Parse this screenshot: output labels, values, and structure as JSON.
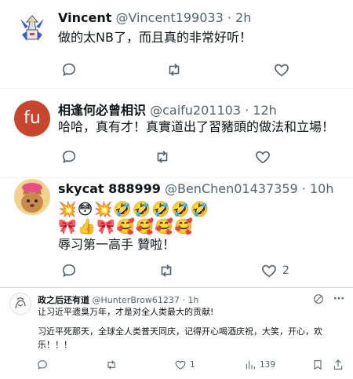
{
  "tweets": [
    {
      "name": "Vincent",
      "handle": "@Vincent199033",
      "time": "2h",
      "text": "做的太NB了，而且真的非常好听！",
      "avatar_icon": "robot-avatar"
    },
    {
      "name": "相逢何必曾相识",
      "handle": "@caifu201103",
      "time": "12h",
      "text": "哈哈，真有才！真實道出了習豬頭的做法和立場！",
      "avatar_text": "fu"
    },
    {
      "name": "skycat 888999",
      "handle": "@BenChen01437359",
      "time": "10h",
      "emoji_line1": "💥😳💥🤣🤣🤣🤣🤣",
      "emoji_line2": "🎀👍🎀🥰🥰🥰🥰",
      "text": "辱习第一高手 贊啦！",
      "like_count": "2",
      "avatar_icon": "cat-avatar"
    },
    {
      "name": "政之后还有道",
      "handle": "@HunterBrow61237",
      "time": "1h",
      "text1": "让习近平遗臭万年，才是对全人类最大的贡献!",
      "text2": "习近平死那天，全球全人类普天同庆，记得开心喝酒庆祝，大笑，开心，欢乐！！！",
      "like_count": "1",
      "views_count": "139",
      "avatar_icon": "sketch-avatar"
    }
  ],
  "separator": "·"
}
